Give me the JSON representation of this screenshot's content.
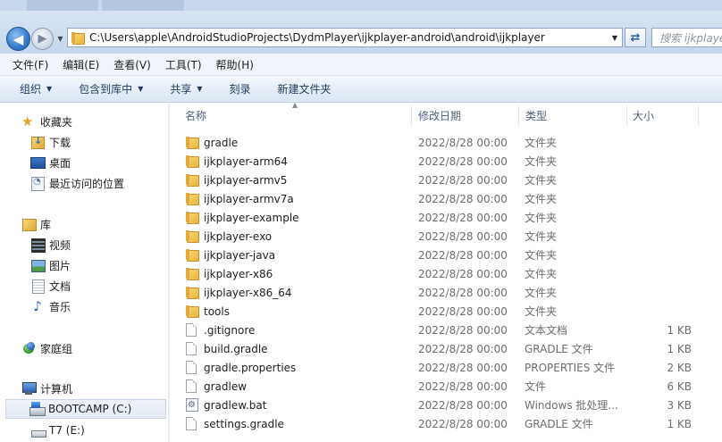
{
  "address_bar": {
    "path": "C:\\Users\\apple\\AndroidStudioProjects\\DydmPlayer\\ijkplayer-android\\android\\ijkplayer",
    "search_placeholder": "搜索 ijkplayer"
  },
  "menu": [
    "文件(F)",
    "编辑(E)",
    "查看(V)",
    "工具(T)",
    "帮助(H)"
  ],
  "commands": [
    {
      "label": "组织",
      "dropdown": true
    },
    {
      "label": "包含到库中",
      "dropdown": true
    },
    {
      "label": "共享",
      "dropdown": true
    },
    {
      "label": "刻录",
      "dropdown": false
    },
    {
      "label": "新建文件夹",
      "dropdown": false
    }
  ],
  "nav": {
    "favorites": {
      "label": "收藏夹",
      "icon": "star-icon",
      "items": [
        {
          "label": "下载",
          "icon": "download-folder-icon"
        },
        {
          "label": "桌面",
          "icon": "desktop-icon"
        },
        {
          "label": "最近访问的位置",
          "icon": "recent-places-icon"
        }
      ]
    },
    "libraries": {
      "label": "库",
      "icon": "library-icon",
      "items": [
        {
          "label": "视频",
          "icon": "video-library-icon"
        },
        {
          "label": "图片",
          "icon": "pictures-library-icon"
        },
        {
          "label": "文档",
          "icon": "documents-library-icon"
        },
        {
          "label": "音乐",
          "icon": "music-library-icon"
        }
      ]
    },
    "homegroup": {
      "label": "家庭组",
      "icon": "homegroup-icon"
    },
    "computer": {
      "label": "计算机",
      "icon": "computer-icon",
      "items": [
        {
          "label": "BOOTCAMP (C:)",
          "icon": "system-drive-icon",
          "selected": true
        },
        {
          "label": "T7 (E:)",
          "icon": "usb-drive-icon",
          "selected": false
        }
      ]
    }
  },
  "columns": {
    "name": "名称",
    "date": "修改日期",
    "type": "类型",
    "size": "大小"
  },
  "files": [
    {
      "name": "gradle",
      "date": "2022/8/28 00:00",
      "type": "文件夹",
      "size": "",
      "kind": "folder"
    },
    {
      "name": "ijkplayer-arm64",
      "date": "2022/8/28 00:00",
      "type": "文件夹",
      "size": "",
      "kind": "folder"
    },
    {
      "name": "ijkplayer-armv5",
      "date": "2022/8/28 00:00",
      "type": "文件夹",
      "size": "",
      "kind": "folder"
    },
    {
      "name": "ijkplayer-armv7a",
      "date": "2022/8/28 00:00",
      "type": "文件夹",
      "size": "",
      "kind": "folder"
    },
    {
      "name": "ijkplayer-example",
      "date": "2022/8/28 00:00",
      "type": "文件夹",
      "size": "",
      "kind": "folder"
    },
    {
      "name": "ijkplayer-exo",
      "date": "2022/8/28 00:00",
      "type": "文件夹",
      "size": "",
      "kind": "folder"
    },
    {
      "name": "ijkplayer-java",
      "date": "2022/8/28 00:00",
      "type": "文件夹",
      "size": "",
      "kind": "folder"
    },
    {
      "name": "ijkplayer-x86",
      "date": "2022/8/28 00:00",
      "type": "文件夹",
      "size": "",
      "kind": "folder"
    },
    {
      "name": "ijkplayer-x86_64",
      "date": "2022/8/28 00:00",
      "type": "文件夹",
      "size": "",
      "kind": "folder"
    },
    {
      "name": "tools",
      "date": "2022/8/28 00:00",
      "type": "文件夹",
      "size": "",
      "kind": "folder"
    },
    {
      "name": ".gitignore",
      "date": "2022/8/28 00:00",
      "type": "文本文档",
      "size": "1 KB",
      "kind": "file"
    },
    {
      "name": "build.gradle",
      "date": "2022/8/28 00:00",
      "type": "GRADLE 文件",
      "size": "1 KB",
      "kind": "file"
    },
    {
      "name": "gradle.properties",
      "date": "2022/8/28 00:00",
      "type": "PROPERTIES 文件",
      "size": "2 KB",
      "kind": "file"
    },
    {
      "name": "gradlew",
      "date": "2022/8/28 00:00",
      "type": "文件",
      "size": "6 KB",
      "kind": "file"
    },
    {
      "name": "gradlew.bat",
      "date": "2022/8/28 00:00",
      "type": "Windows 批处理...",
      "size": "3 KB",
      "kind": "batch"
    },
    {
      "name": "settings.gradle",
      "date": "2022/8/28 00:00",
      "type": "GRADLE 文件",
      "size": "1 KB",
      "kind": "file"
    }
  ]
}
